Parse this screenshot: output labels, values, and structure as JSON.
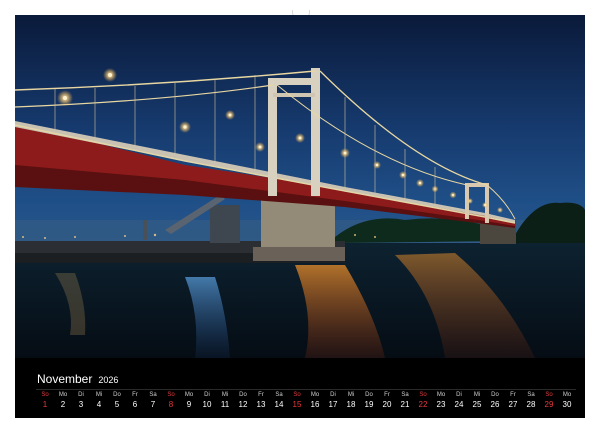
{
  "calendar": {
    "month": "November",
    "year": "2026",
    "days": [
      {
        "name": "So",
        "num": "1",
        "type": "sun"
      },
      {
        "name": "Mo",
        "num": "2",
        "type": "wk"
      },
      {
        "name": "Di",
        "num": "3",
        "type": "wk"
      },
      {
        "name": "Mi",
        "num": "4",
        "type": "wk"
      },
      {
        "name": "Do",
        "num": "5",
        "type": "wk"
      },
      {
        "name": "Fr",
        "num": "6",
        "type": "wk"
      },
      {
        "name": "Sa",
        "num": "7",
        "type": "sat"
      },
      {
        "name": "So",
        "num": "8",
        "type": "sun"
      },
      {
        "name": "Mo",
        "num": "9",
        "type": "wk"
      },
      {
        "name": "Di",
        "num": "10",
        "type": "wk"
      },
      {
        "name": "Mi",
        "num": "11",
        "type": "wk"
      },
      {
        "name": "Do",
        "num": "12",
        "type": "wk"
      },
      {
        "name": "Fr",
        "num": "13",
        "type": "wk"
      },
      {
        "name": "Sa",
        "num": "14",
        "type": "sat"
      },
      {
        "name": "So",
        "num": "15",
        "type": "sun"
      },
      {
        "name": "Mo",
        "num": "16",
        "type": "wk"
      },
      {
        "name": "Di",
        "num": "17",
        "type": "wk"
      },
      {
        "name": "Mi",
        "num": "18",
        "type": "wk"
      },
      {
        "name": "Do",
        "num": "19",
        "type": "wk"
      },
      {
        "name": "Fr",
        "num": "20",
        "type": "wk"
      },
      {
        "name": "Sa",
        "num": "21",
        "type": "sat"
      },
      {
        "name": "So",
        "num": "22",
        "type": "sun"
      },
      {
        "name": "Mo",
        "num": "23",
        "type": "wk"
      },
      {
        "name": "Di",
        "num": "24",
        "type": "wk"
      },
      {
        "name": "Mi",
        "num": "25",
        "type": "wk"
      },
      {
        "name": "Do",
        "num": "26",
        "type": "wk"
      },
      {
        "name": "Fr",
        "num": "27",
        "type": "wk"
      },
      {
        "name": "Sa",
        "num": "28",
        "type": "sat"
      },
      {
        "name": "So",
        "num": "29",
        "type": "sun"
      },
      {
        "name": "Mo",
        "num": "30",
        "type": "wk"
      }
    ]
  },
  "colors": {
    "sunday": "#e8383d",
    "weekday": "#ffffff",
    "background": "#000000"
  }
}
